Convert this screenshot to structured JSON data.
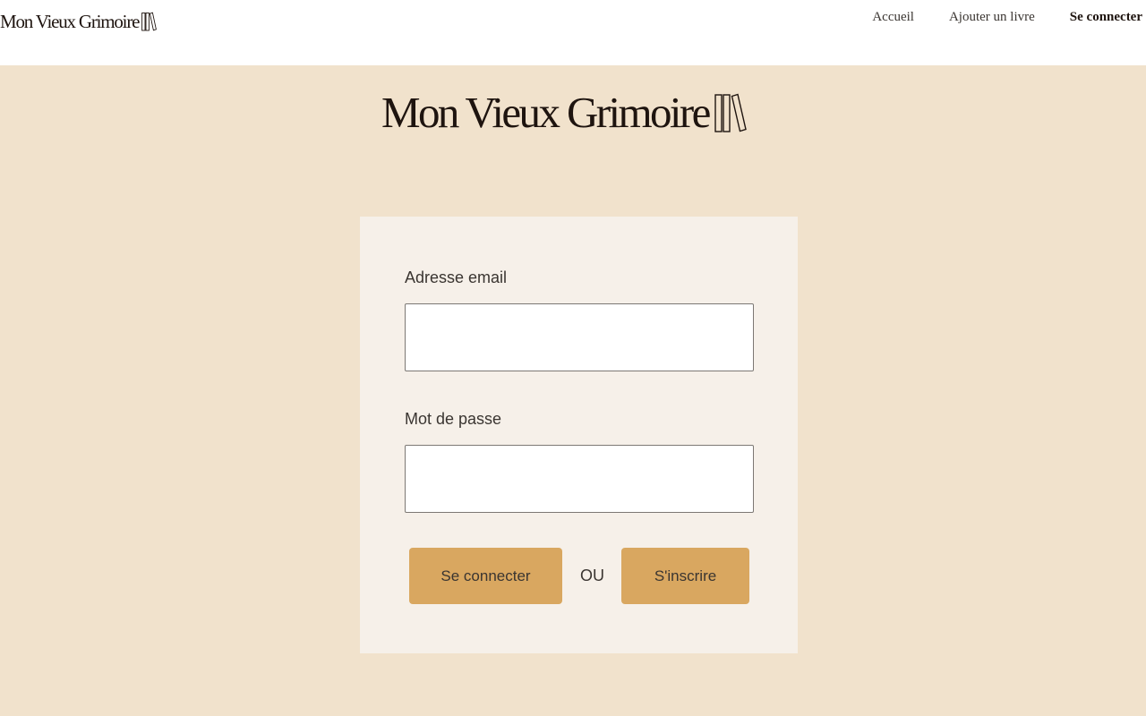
{
  "header": {
    "logo_text": "Mon Vieux Grimoire",
    "nav": [
      {
        "label": "Accueil"
      },
      {
        "label": "Ajouter un livre"
      },
      {
        "label": "Se connecter"
      }
    ]
  },
  "hero": {
    "logo_text": "Mon Vieux Grimoire"
  },
  "login_form": {
    "email_label": "Adresse email",
    "email_value": "",
    "password_label": "Mot de passe",
    "password_value": "",
    "login_button": "Se connecter",
    "separator": "OU",
    "signup_button": "S'inscrire"
  },
  "colors": {
    "page_background": "#F1E2CC",
    "header_background": "#FFFFFF",
    "card_background": "#F6F0E9",
    "button_accent": "#D9A760",
    "text_dark": "#1E140F"
  },
  "icons": {
    "logo": "books-icon"
  }
}
